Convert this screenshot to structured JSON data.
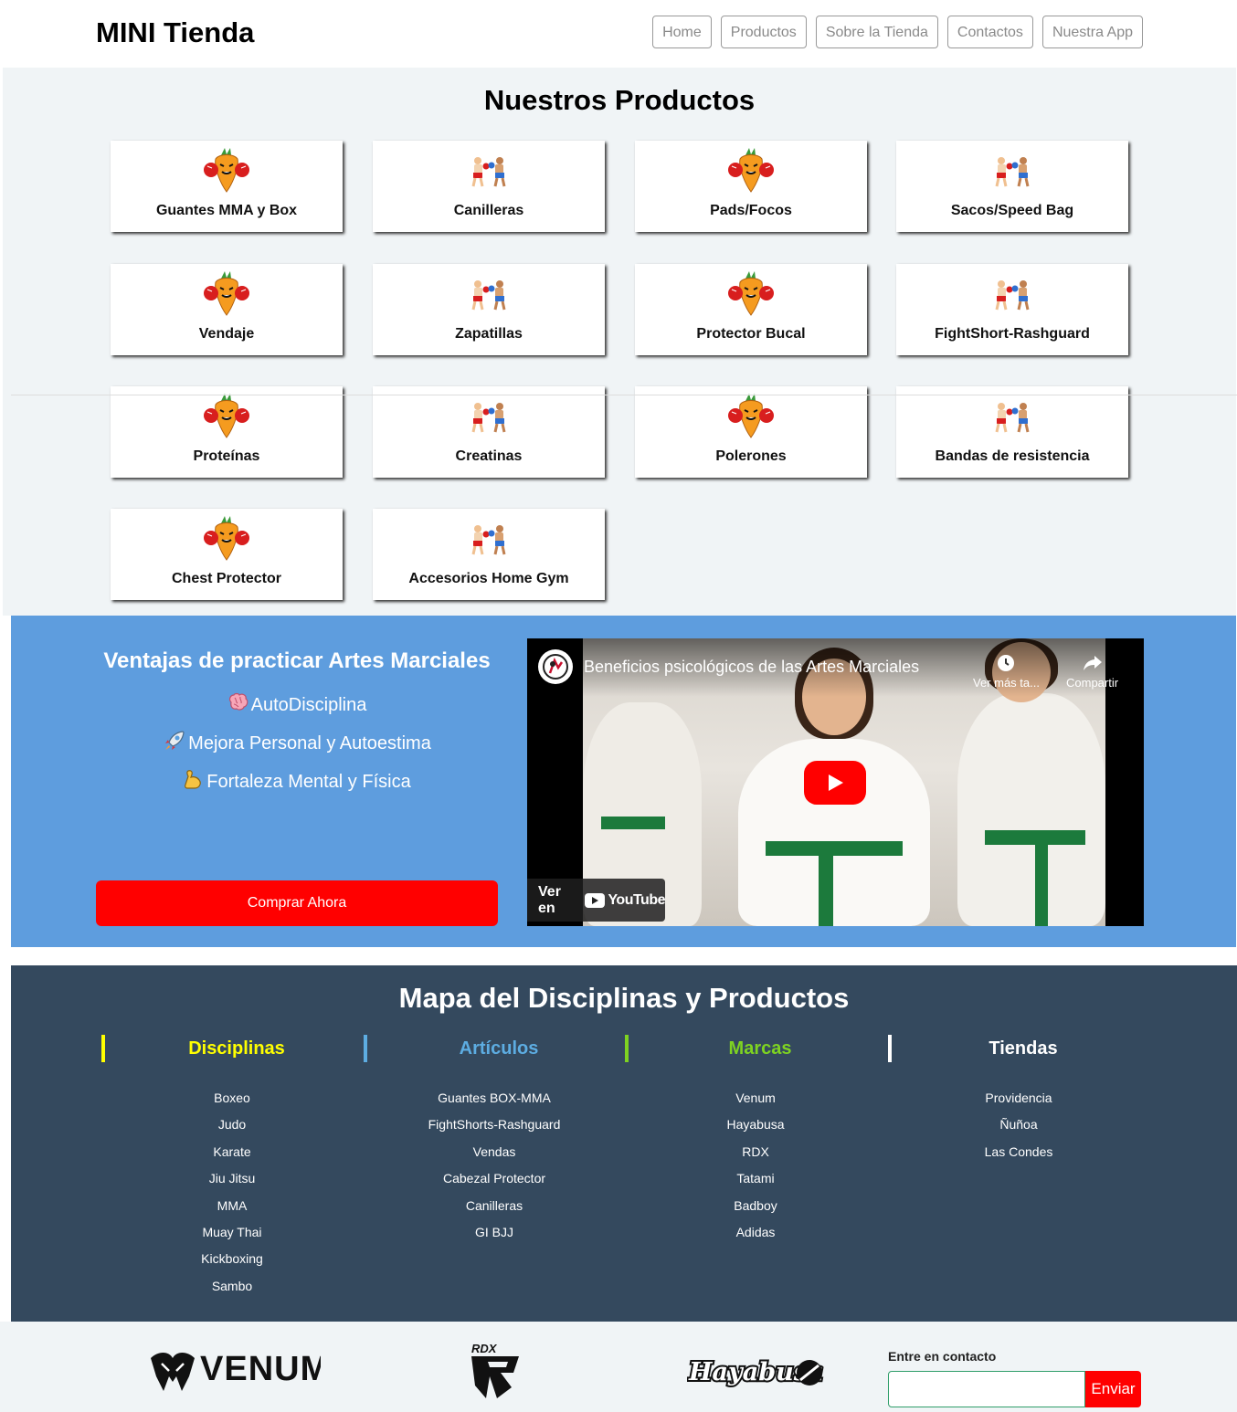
{
  "header": {
    "logo": "MINI Tienda",
    "nav": [
      "Home",
      "Productos",
      "Sobre la Tienda",
      "Contactos",
      "Nuestra App"
    ]
  },
  "products": {
    "title": "Nuestros Productos",
    "items": [
      {
        "label": "Guantes MMA y Box",
        "icon": "carrot-boxer-icon"
      },
      {
        "label": "Canilleras",
        "icon": "boxers-icon"
      },
      {
        "label": "Pads/Focos",
        "icon": "carrot-boxer-icon"
      },
      {
        "label": "Sacos/Speed Bag",
        "icon": "boxers-icon"
      },
      {
        "label": "Vendaje",
        "icon": "carrot-boxer-icon"
      },
      {
        "label": "Zapatillas",
        "icon": "boxers-icon"
      },
      {
        "label": "Protector Bucal",
        "icon": "carrot-boxer-icon"
      },
      {
        "label": "FightShort-Rashguard",
        "icon": "boxers-icon"
      },
      {
        "label": "Proteínas",
        "icon": "carrot-boxer-icon"
      },
      {
        "label": "Creatinas",
        "icon": "boxers-icon"
      },
      {
        "label": "Polerones",
        "icon": "carrot-boxer-icon"
      },
      {
        "label": "Bandas de resistencia",
        "icon": "boxers-icon"
      },
      {
        "label": "Chest Protector",
        "icon": "carrot-boxer-icon"
      },
      {
        "label": "Accesorios Home Gym",
        "icon": "boxers-icon"
      }
    ]
  },
  "hero": {
    "title": "Ventajas de practicar Artes Marciales",
    "benefits": [
      {
        "icon": "brain-icon",
        "text": "AutoDisciplina"
      },
      {
        "icon": "rocket-icon",
        "text": "Mejora Personal y Autoestima"
      },
      {
        "icon": "flexed-biceps-icon",
        "text": "Fortaleza Mental y Física"
      }
    ],
    "cta": "Comprar Ahora",
    "video": {
      "title": "Beneficios psicológicos de las Artes Marciales",
      "watch_later": "Ver más ta...",
      "share": "Compartir",
      "watch_on": "Ver en",
      "platform": "YouTube"
    }
  },
  "map": {
    "title": "Mapa del Disciplinas y Productos",
    "columns": [
      {
        "title": "Disciplinas",
        "color": "#ffff00",
        "items": [
          "Boxeo",
          "Judo",
          "Karate",
          "Jiu Jitsu",
          "MMA",
          "Muay Thai",
          "Kickboxing",
          "Sambo"
        ]
      },
      {
        "title": "Artículos",
        "color": "#5dade2",
        "items": [
          "Guantes BOX-MMA",
          "FightShorts-Rashguard",
          "Vendas",
          "Cabezal Protector",
          "Canilleras",
          "GI BJJ"
        ]
      },
      {
        "title": "Marcas",
        "color": "#7ed321",
        "items": [
          "Venum",
          "Hayabusa",
          "RDX",
          "Tatami",
          "Badboy",
          "Adidas"
        ]
      },
      {
        "title": "Tiendas",
        "color": "#ffffff",
        "items": [
          "Providencia",
          "Ñuñoa",
          "Las Condes"
        ]
      }
    ]
  },
  "footer": {
    "brands": [
      "VENUM",
      "RDX",
      "Hayabusa"
    ],
    "contact_label": "Entre en contacto",
    "input_placeholder": "",
    "send": "Enviar"
  }
}
